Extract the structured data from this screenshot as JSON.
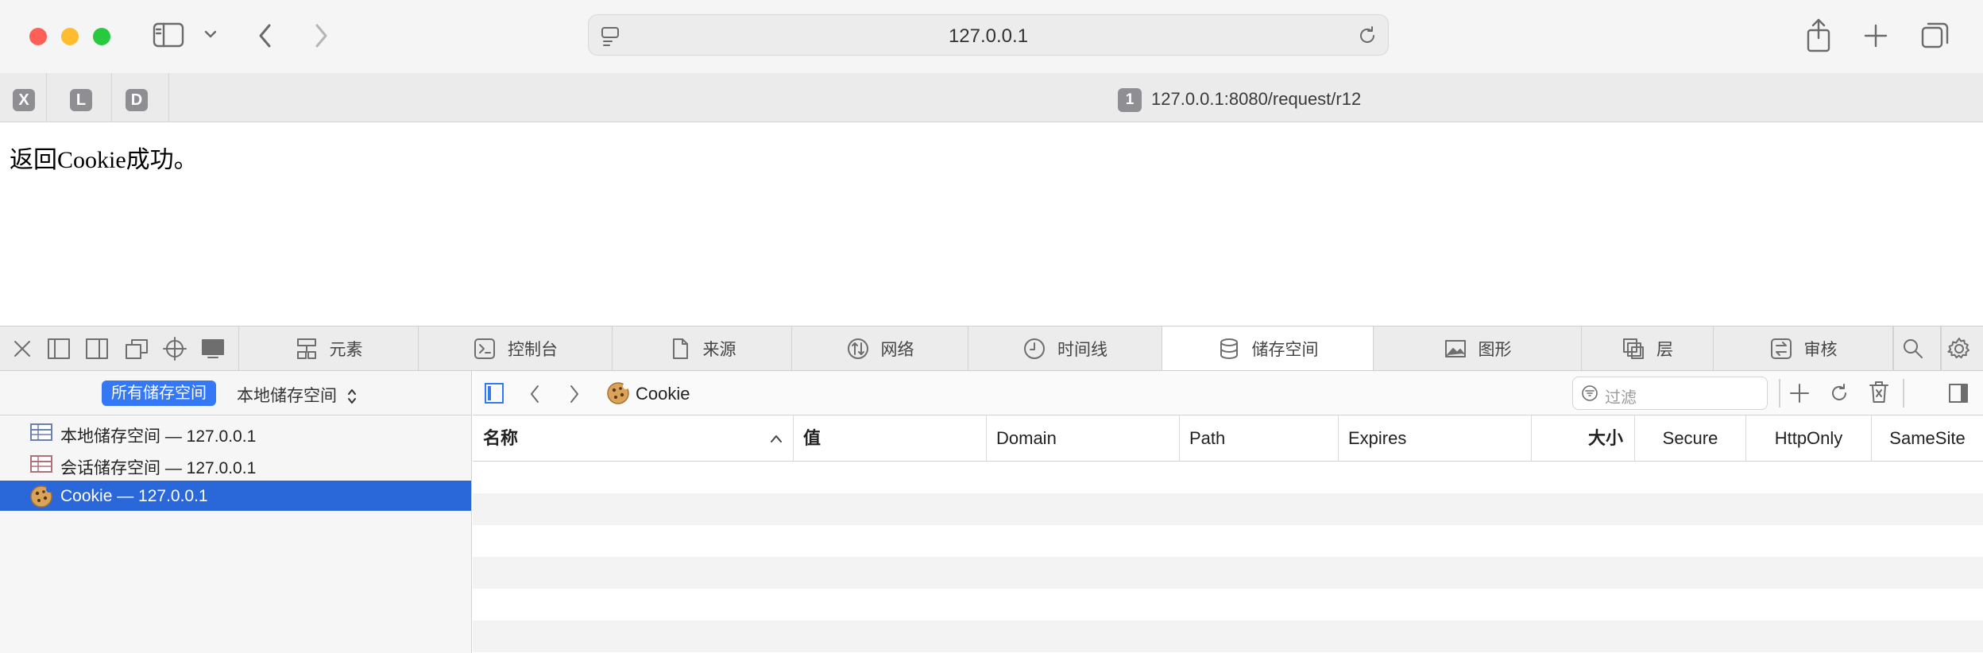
{
  "browser": {
    "address": "127.0.0.1",
    "pinned_tabs": [
      "X",
      "L",
      "D"
    ],
    "active_tab": {
      "badge": "1",
      "title": "127.0.0.1:8080/request/r12"
    }
  },
  "page": {
    "text": "返回Cookie成功。"
  },
  "devtools": {
    "tabs": [
      {
        "label": "元素",
        "icon": "elements-icon"
      },
      {
        "label": "控制台",
        "icon": "console-icon"
      },
      {
        "label": "来源",
        "icon": "document-icon"
      },
      {
        "label": "网络",
        "icon": "network-icon"
      },
      {
        "label": "时间线",
        "icon": "timeline-icon"
      },
      {
        "label": "储存空间",
        "icon": "database-icon"
      },
      {
        "label": "图形",
        "icon": "image-icon"
      },
      {
        "label": "层",
        "icon": "layers-icon"
      },
      {
        "label": "审核",
        "icon": "audit-icon"
      }
    ],
    "active_tab": "储存空间",
    "sidebar": {
      "all_button": "所有储存空间",
      "selector": "本地储存空间",
      "items": [
        {
          "label": "本地储存空间 — 127.0.0.1",
          "icon": "table-icon"
        },
        {
          "label": "会话储存空间 — 127.0.0.1",
          "icon": "table-icon"
        },
        {
          "label": "Cookie — 127.0.0.1",
          "icon": "cookie-icon",
          "selected": true
        }
      ]
    },
    "panel": {
      "breadcrumb": "Cookie",
      "filter_placeholder": "过滤",
      "columns": [
        "名称",
        "值",
        "Domain",
        "Path",
        "Expires",
        "大小",
        "Secure",
        "HttpOnly",
        "SameSite"
      ],
      "rows": []
    },
    "colors": {
      "accent": "#3478f6",
      "selection": "#2a67d8"
    }
  }
}
